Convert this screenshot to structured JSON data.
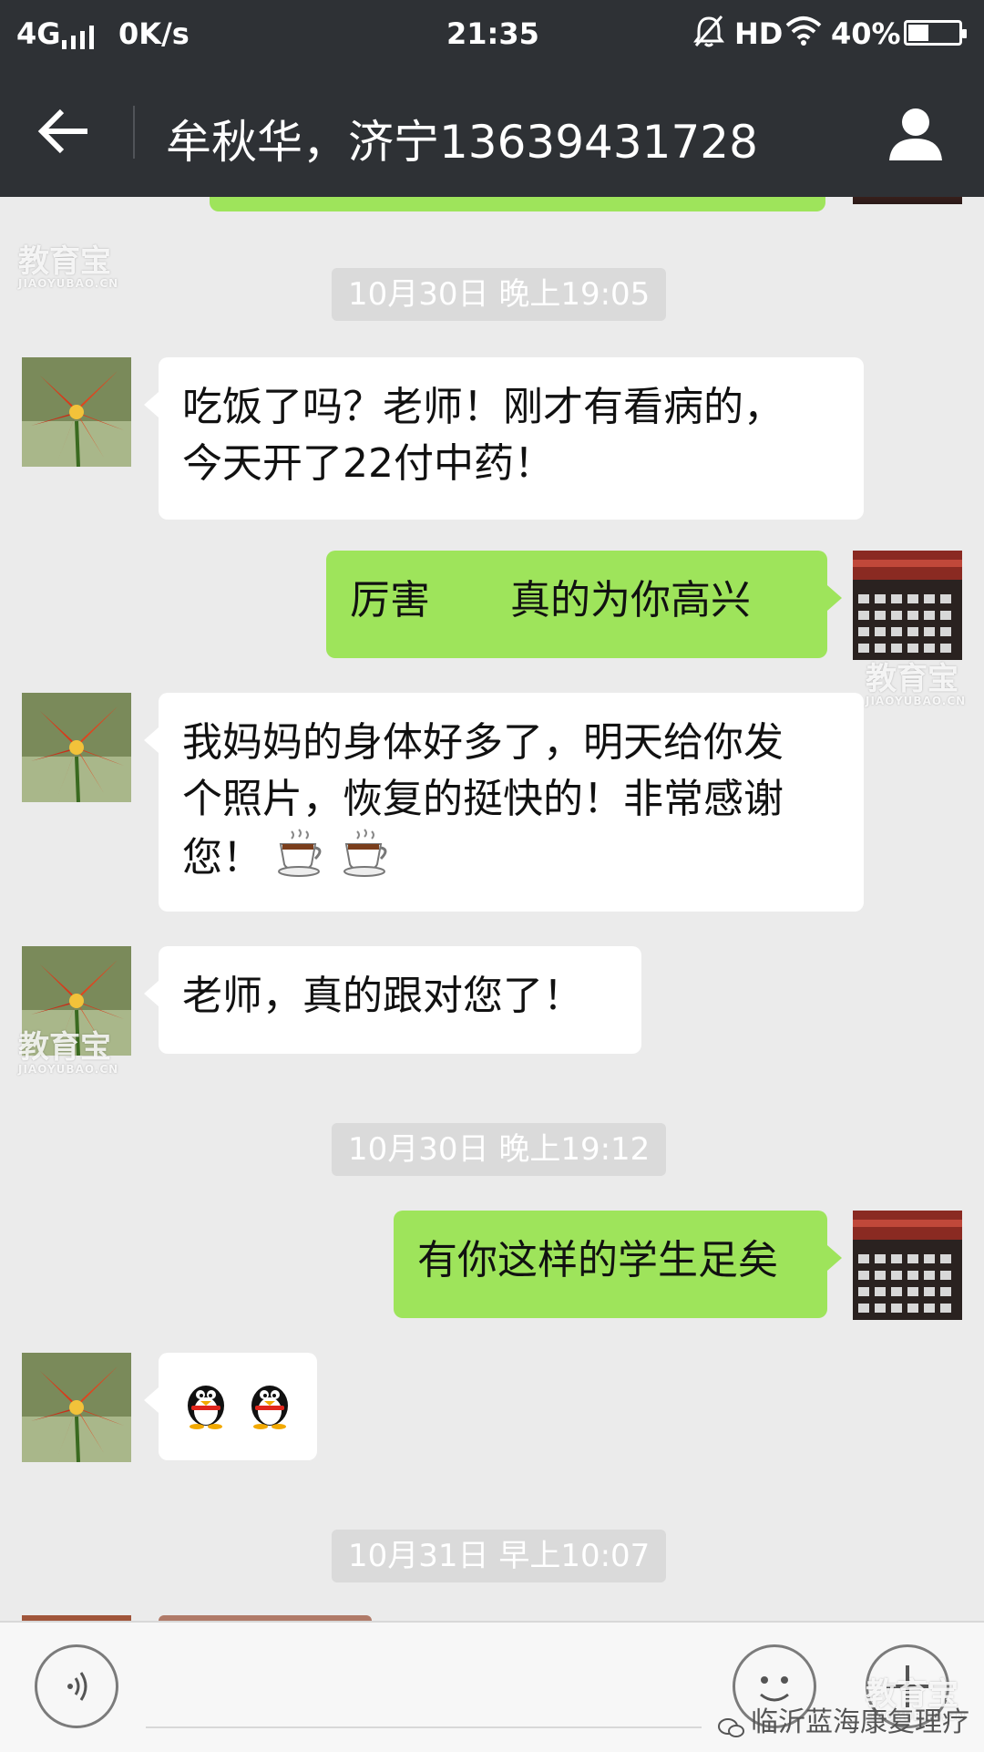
{
  "status_bar": {
    "network": "4G",
    "speed": "0K/s",
    "time": "21:35",
    "hd": "HD",
    "battery": "40%",
    "battery_level": 0.4
  },
  "header": {
    "title": "牟秋华，济宁13639431728"
  },
  "messages": [
    {
      "type": "timestamp",
      "text": "10月30日 晚上19:05"
    },
    {
      "type": "in",
      "lines": [
        "吃饭了吗？老师！刚才有看病的，",
        "今天开了22付中药！"
      ]
    },
    {
      "type": "out",
      "lines": [
        "厉害　　真的为你高兴"
      ]
    },
    {
      "type": "in",
      "lines": [
        "我妈妈的身体好多了，明天给你发",
        "个照片，恢复的挺快的！非常感谢",
        "您！"
      ],
      "emoji": [
        "coffee-cup-icon",
        "coffee-cup-icon"
      ]
    },
    {
      "type": "in",
      "lines": [
        "老师，真的跟对您了！"
      ]
    },
    {
      "type": "timestamp",
      "text": "10月30日 晚上19:12"
    },
    {
      "type": "out",
      "lines": [
        "有你这样的学生足矣"
      ]
    },
    {
      "type": "in",
      "emoji": [
        "penguin-icon",
        "penguin-icon"
      ]
    },
    {
      "type": "timestamp",
      "text": "10月31日 早上10:07"
    }
  ],
  "watermark": {
    "text": "教育宝",
    "subtext": "JIAOYUBAO.CN"
  },
  "footer": {
    "brand": "临沂蓝海康复理疗"
  },
  "colors": {
    "header_bg": "#2e3135",
    "chat_bg": "#ebebeb",
    "outgoing_bubble": "#9ee45b",
    "incoming_bubble": "#ffffff",
    "timestamp_bg": "#dadada"
  }
}
